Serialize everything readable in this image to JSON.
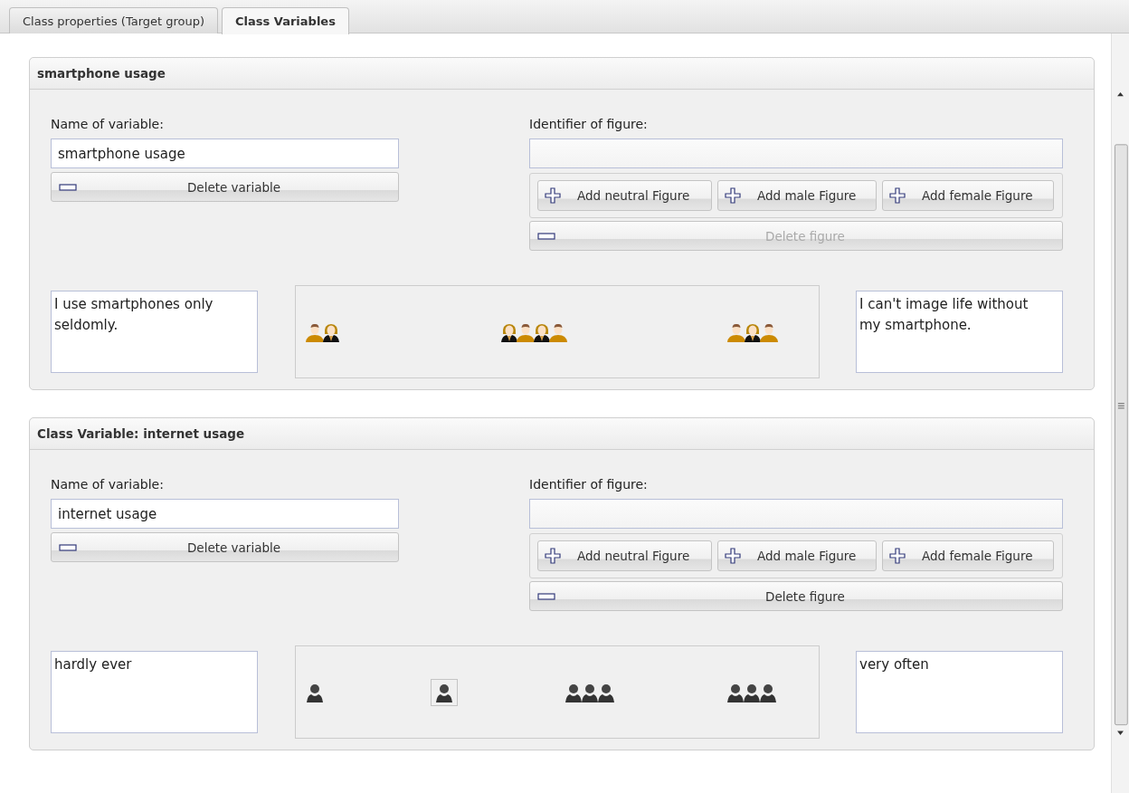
{
  "tabs": [
    {
      "label": "Class properties (Target group)",
      "selected": false
    },
    {
      "label": "Class Variables",
      "selected": true
    }
  ],
  "panels": [
    {
      "title": "smartphone usage",
      "name_label": "Name of variable:",
      "name_value": "smartphone usage",
      "delete_variable": "Delete variable",
      "identifier_label": "Identifier of figure:",
      "add_buttons": [
        "Add neutral Figure",
        "Add male Figure",
        "Add female Figure"
      ],
      "delete_figure": {
        "label": "Delete figure",
        "disabled": true
      },
      "left_text": "I use smartphones only seldomly.",
      "right_text": "I can't image life without my smartphone.",
      "groups": [
        {
          "selected": false,
          "members": [
            {
              "kind": "male"
            },
            {
              "kind": "female"
            }
          ]
        },
        {
          "selected": false,
          "members": [
            {
              "kind": "female"
            },
            {
              "kind": "male"
            },
            {
              "kind": "female"
            },
            {
              "kind": "male"
            }
          ]
        },
        {
          "selected": false,
          "members": [
            {
              "kind": "male"
            },
            {
              "kind": "female"
            },
            {
              "kind": "male"
            }
          ]
        }
      ]
    },
    {
      "title": "Class Variable: internet usage",
      "name_label": "Name of variable:",
      "name_value": "internet usage",
      "delete_variable": "Delete variable",
      "identifier_label": "Identifier of figure:",
      "add_buttons": [
        "Add neutral Figure",
        "Add male Figure",
        "Add female Figure"
      ],
      "delete_figure": {
        "label": "Delete figure",
        "disabled": false
      },
      "left_text": "hardly ever",
      "right_text": "very often",
      "groups": [
        {
          "selected": false,
          "members": [
            {
              "kind": "neutral"
            }
          ]
        },
        {
          "selected": true,
          "members": [
            {
              "kind": "neutral"
            }
          ]
        },
        {
          "selected": false,
          "members": [
            {
              "kind": "neutral"
            },
            {
              "kind": "neutral"
            },
            {
              "kind": "neutral"
            }
          ]
        },
        {
          "selected": false,
          "members": [
            {
              "kind": "neutral"
            },
            {
              "kind": "neutral"
            },
            {
              "kind": "neutral"
            }
          ]
        }
      ]
    }
  ]
}
